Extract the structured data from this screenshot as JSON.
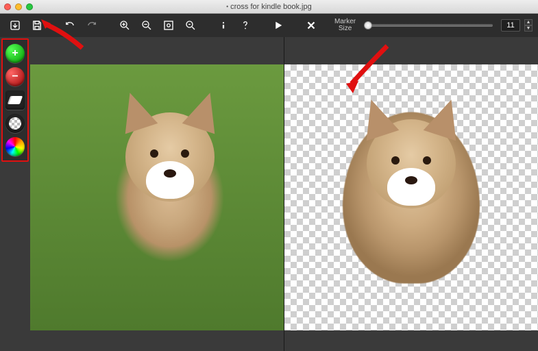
{
  "window": {
    "modified_indicator": "•",
    "filename": "cross for kindle book.jpg"
  },
  "toolbar": {
    "marker_label_line1": "Marker",
    "marker_label_line2": "Size",
    "marker_value": "11",
    "stepper_up": "▲",
    "stepper_down": "▼"
  },
  "side_tools": {
    "add_label": "+",
    "subtract_label": "−"
  },
  "icons": {
    "open": "open-icon",
    "save": "save-icon",
    "undo": "undo-icon",
    "redo": "redo-icon",
    "zoom_in": "zoom-in-icon",
    "zoom_out": "zoom-out-icon",
    "zoom_fit": "zoom-fit-icon",
    "zoom_actual": "zoom-actual-icon",
    "info": "info-icon",
    "help": "help-icon",
    "play": "play-icon",
    "clear": "clear-icon"
  }
}
